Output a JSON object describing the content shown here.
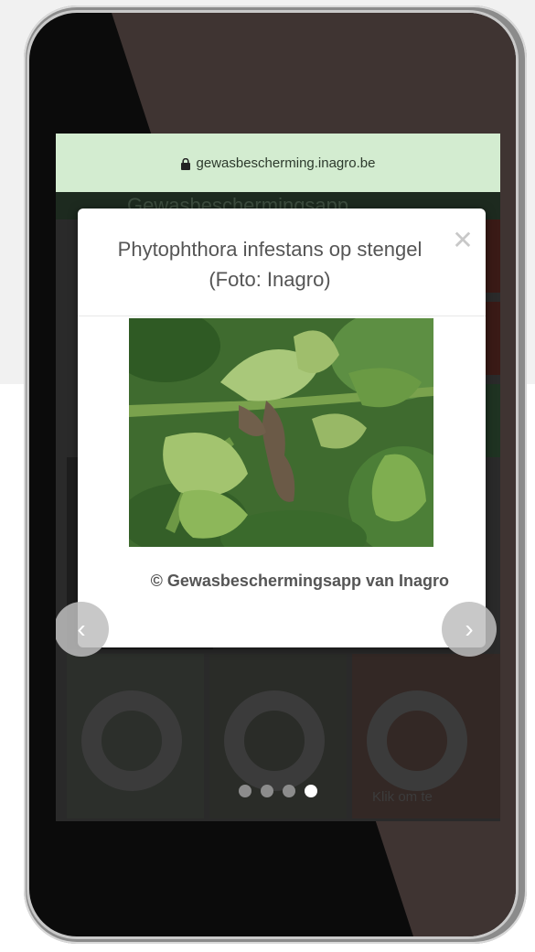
{
  "browser": {
    "url": "gewasbescherming.inagro.be"
  },
  "background_page": {
    "header_text": "Gewasbeschermingsapp",
    "tile_caption": "Klik om te"
  },
  "modal": {
    "title": "Phytophthora infestans op stengel (Foto: Inagro)",
    "close_symbol": "✕",
    "caption": "© Gewasbeschermingsapp van Inagro",
    "prev_symbol": "‹",
    "next_symbol": "›"
  },
  "carousel": {
    "dot_count": 4,
    "active_index": 3
  },
  "colors": {
    "urlbar": "#d3ecd0",
    "phone_frame": "#8b8b8b",
    "overlay": "#242424"
  },
  "icons": [
    "lock-icon",
    "close-icon",
    "chevron-left-icon",
    "chevron-right-icon"
  ]
}
